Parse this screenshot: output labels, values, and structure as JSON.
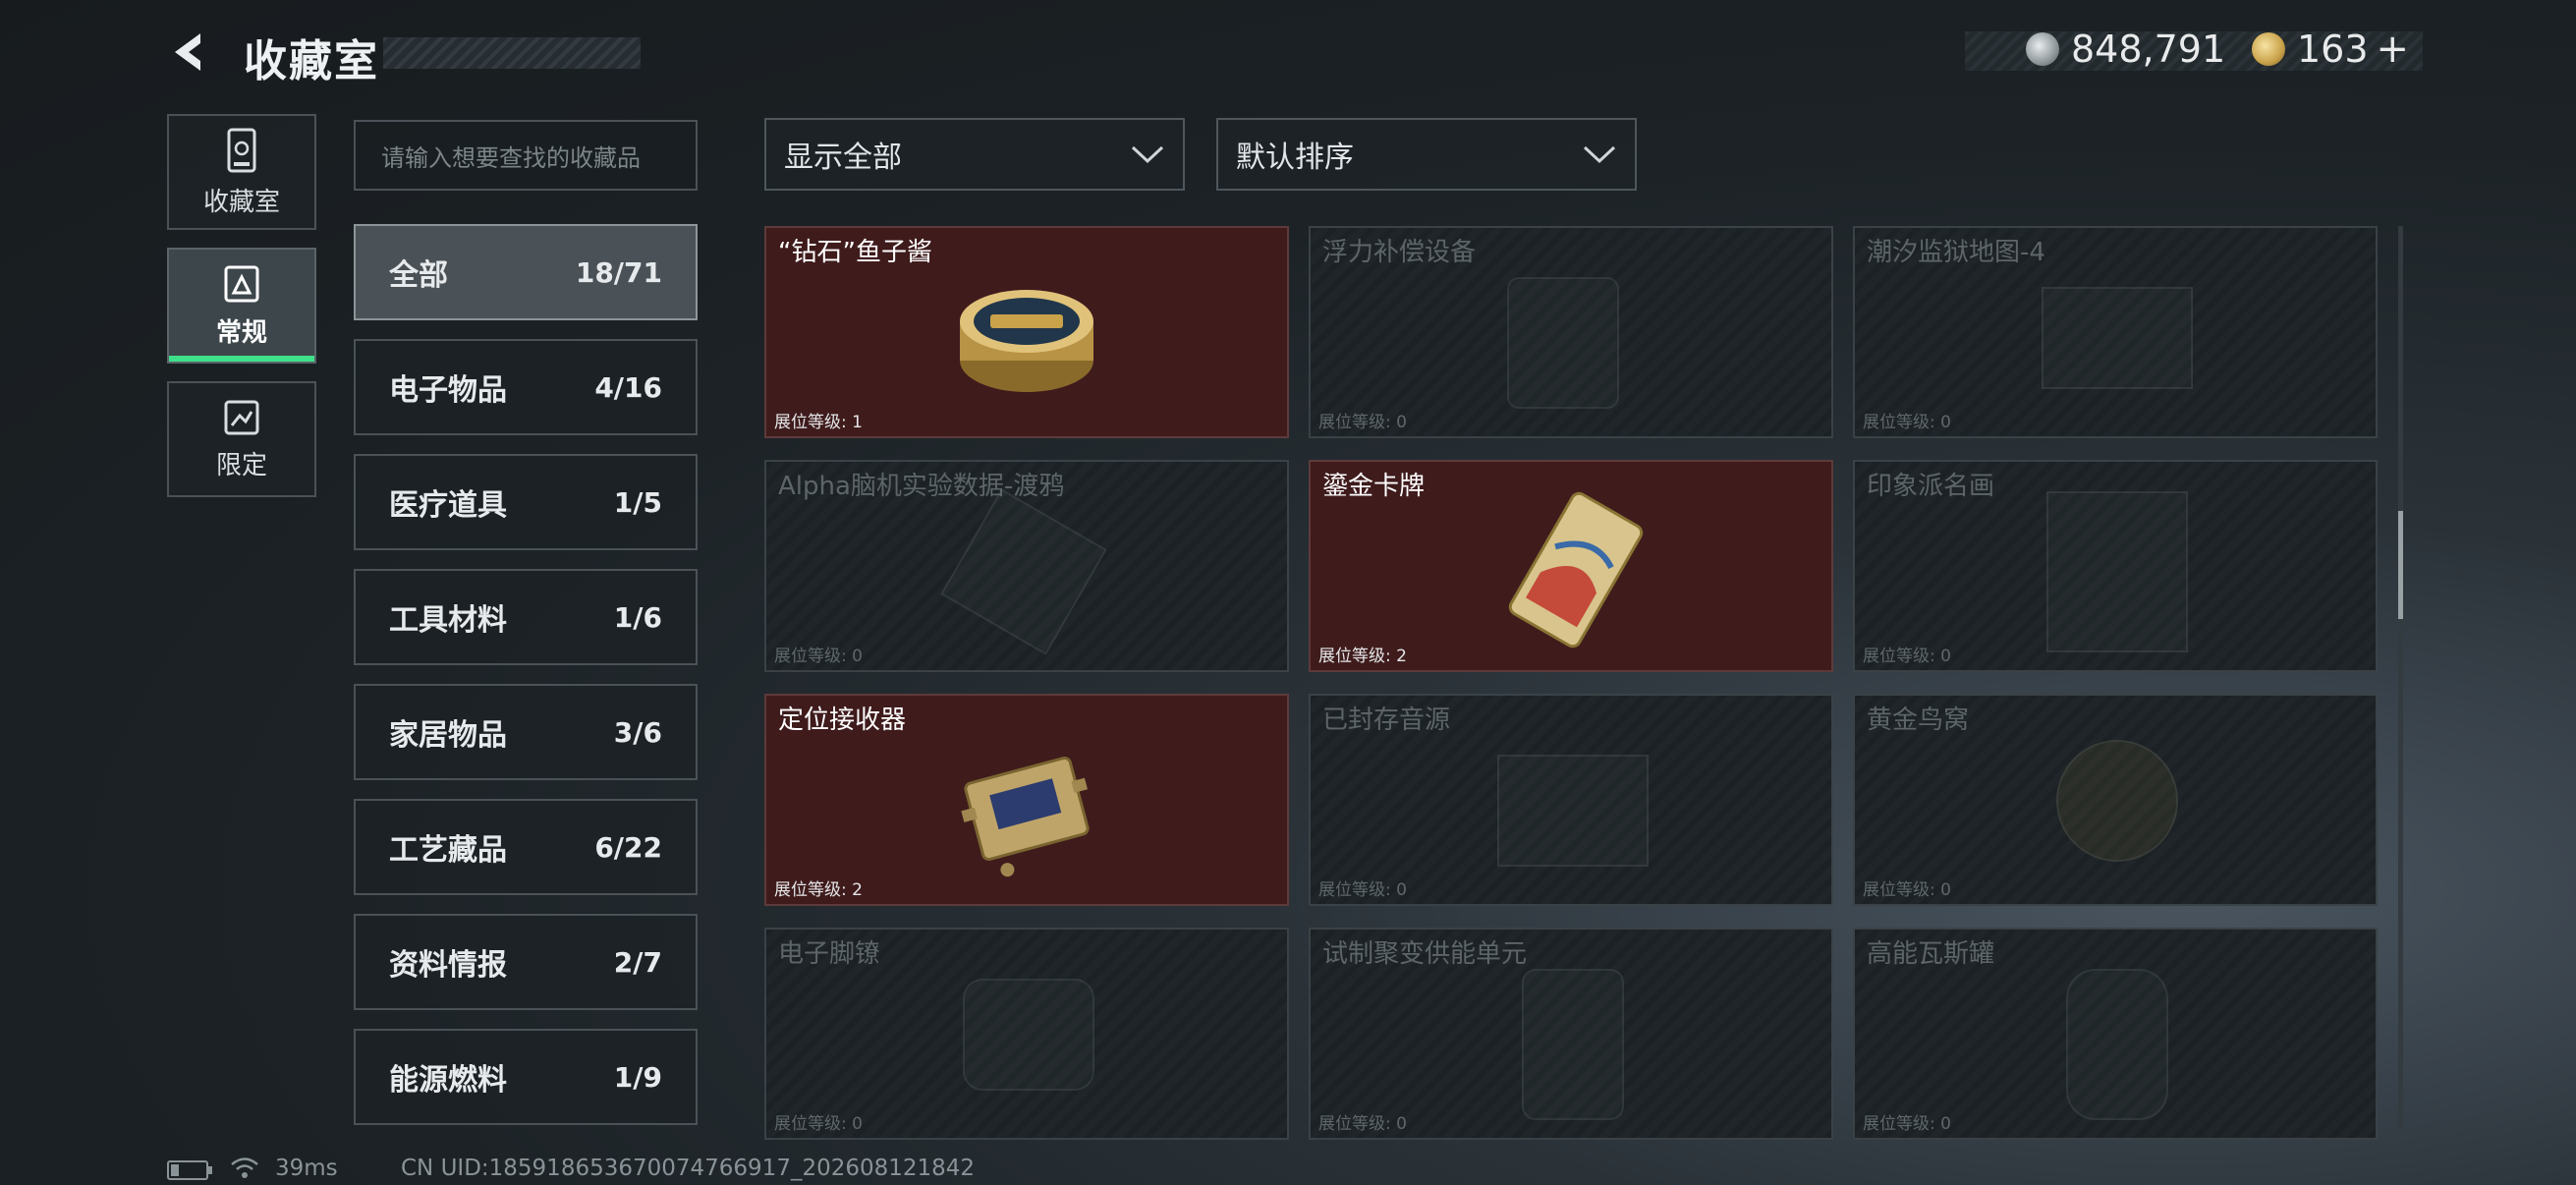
{
  "header": {
    "title": "收藏室",
    "currency_silver": "848,791",
    "currency_gold": "163",
    "add_label": "+"
  },
  "sidebar": {
    "items": [
      {
        "label": "收藏室",
        "icon": "collection-icon"
      },
      {
        "label": "常规",
        "icon": "regular-icon",
        "active": true
      },
      {
        "label": "限定",
        "icon": "limited-icon"
      }
    ]
  },
  "search": {
    "placeholder": "请输入想要查找的收藏品"
  },
  "filters": {
    "display": "显示全部",
    "sort": "默认排序"
  },
  "categories": [
    {
      "label": "全部",
      "count": "18/71",
      "active": true
    },
    {
      "label": "电子物品",
      "count": "4/16"
    },
    {
      "label": "医疗道具",
      "count": "1/5"
    },
    {
      "label": "工具材料",
      "count": "1/6"
    },
    {
      "label": "家居物品",
      "count": "3/6"
    },
    {
      "label": "工艺藏品",
      "count": "6/22"
    },
    {
      "label": "资料情报",
      "count": "2/7"
    },
    {
      "label": "能源燃料",
      "count": "1/9"
    }
  ],
  "level_prefix": "展位等级:",
  "items": [
    {
      "name": "“钻石”鱼子酱",
      "level": "1",
      "owned": true,
      "icon": "caviar-tin-icon"
    },
    {
      "name": "浮力补偿设备",
      "level": "0",
      "owned": false,
      "icon": "bcd-device-icon"
    },
    {
      "name": "潮汐监狱地图-4",
      "level": "0",
      "owned": false,
      "icon": "map-icon"
    },
    {
      "name": "Alpha脑机实验数据-渡鸦",
      "level": "0",
      "owned": false,
      "icon": "data-drive-icon"
    },
    {
      "name": "鎏金卡牌",
      "level": "2",
      "owned": true,
      "icon": "gilded-card-icon"
    },
    {
      "name": "印象派名画",
      "level": "0",
      "owned": false,
      "icon": "painting-icon"
    },
    {
      "name": "定位接收器",
      "level": "2",
      "owned": true,
      "icon": "locator-receiver-icon"
    },
    {
      "name": "已封存音源",
      "level": "0",
      "owned": false,
      "icon": "audio-source-icon"
    },
    {
      "name": "黄金鸟窝",
      "level": "0",
      "owned": false,
      "icon": "golden-nest-icon"
    },
    {
      "name": "电子脚镣",
      "level": "0",
      "owned": false,
      "icon": "ankle-monitor-icon"
    },
    {
      "name": "试制聚变供能单元",
      "level": "0",
      "owned": false,
      "icon": "fusion-cell-icon"
    },
    {
      "name": "高能瓦斯罐",
      "level": "0",
      "owned": false,
      "icon": "gas-canister-icon"
    }
  ],
  "status": {
    "ping": "39ms",
    "uid": "CN UID:185918653670074766917_202608121842"
  }
}
